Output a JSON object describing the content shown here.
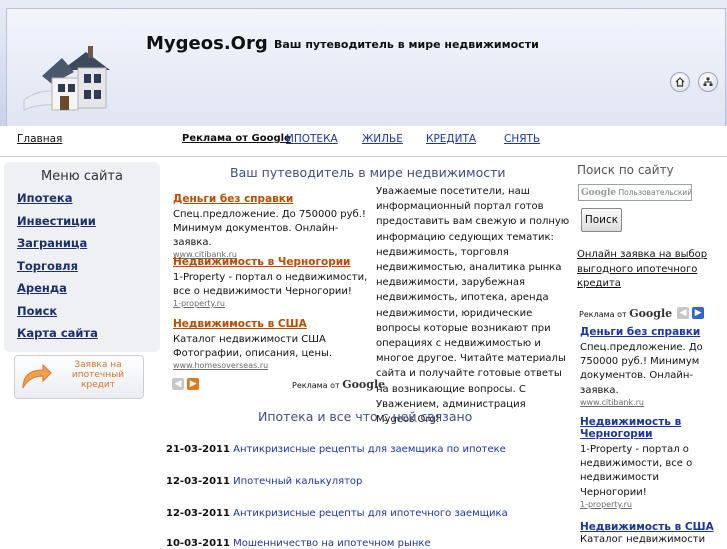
{
  "header": {
    "site_title": "Mygeos.Org",
    "tagline": "Ваш путеводитель в мире недвижимости"
  },
  "nav": {
    "home": "Главная",
    "ads_label": "Реклама от Google",
    "links": [
      "ИПОТЕКА",
      "ЖИЛЬЕ",
      "КРЕДИТА",
      "СНЯТЬ"
    ]
  },
  "menu": {
    "title": "Меню сайта",
    "items": [
      "Ипотека",
      "Инвестиции",
      "Заграница",
      "Торговля",
      "Аренда",
      "Поиск",
      "Карта сайта"
    ],
    "application_banner": "Заявка на ипотечный кредит"
  },
  "center": {
    "title": "Ваш путеводитель в мире недвижимости",
    "ads": [
      {
        "title": "Деньги без справки",
        "text": "Спец.предложение. До 750000 руб.! Минимум документов. Онлайн-заявка.",
        "url": "www.citibank.ru"
      },
      {
        "title": "Недвижимость в Черногории",
        "text": "1-Property - портал о недвижимости, все о недвижимости Черногории!",
        "url": "1-property.ru"
      },
      {
        "title": "Недвижимость в США",
        "text": "Каталог недвижимости США Фотографии, описания, цены.",
        "url": "www.homesoverseas.ru"
      }
    ],
    "ads_by": "Реклама от",
    "google": "Google",
    "intro": "Уважаемые посетители, наш информационный портал готов предоставить вам свежую и полную информацию седующих тематик: недвижимость, торговля недвижимостью, аналитика рынка недвижимости, зарубежная недвижимость, ипотека, аренда недвижимости, юридические вопросы которые возникают при операциях с недвижимостью и многое другое. Читайте материалы сайта и получайте готовые ответы на возникающие вопросы. С Уважением, администрация Mygeos.Org!",
    "section_title": "Ипотека и все что с ней связано",
    "news": [
      {
        "date": "21-03-2011",
        "title": "Антикризисные рецепты для заемщика по ипотеке"
      },
      {
        "date": "12-03-2011",
        "title": "Ипотечный калькулятор"
      },
      {
        "date": "12-03-2011",
        "title": "Антикризисные рецепты для ипотечного заемщика"
      },
      {
        "date": "10-03-2011",
        "title": "Мошенничество на ипотечном рынке"
      }
    ]
  },
  "right": {
    "search_title": "Поиск по сайту",
    "search_google": "Google",
    "search_placeholder": "Пользовательский поиск",
    "search_button": "Поиск",
    "online_link": "Онлайн заявка на выбор выгодного ипотечного кредита",
    "ads_by": "Реклама от",
    "google": "Google",
    "ads": [
      {
        "title": "Деньги без справки",
        "text": "Спец.предложение. До 750000 руб.! Минимум документов. Онлайн-заявка.",
        "url": "www.citibank.ru"
      },
      {
        "title": "Недвижимость в Черногории",
        "text": "1-Property - портал о недвижимости, все о недвижимости Черногории!",
        "url": "1-property.ru"
      },
      {
        "title": "Недвижимость в США",
        "text": "Каталог недвижимости"
      }
    ]
  },
  "colors": {
    "ad_title": "#c04a00",
    "link": "#1a35a6",
    "heading": "#3b4f83",
    "arrow_orange": "#e0781e",
    "arrow_blue": "#2c6ac7"
  },
  "icons": [
    "house-logo-icon",
    "home-icon",
    "sitemap-icon",
    "arrow-left-icon",
    "arrow-right-icon",
    "curved-arrow-icon"
  ]
}
